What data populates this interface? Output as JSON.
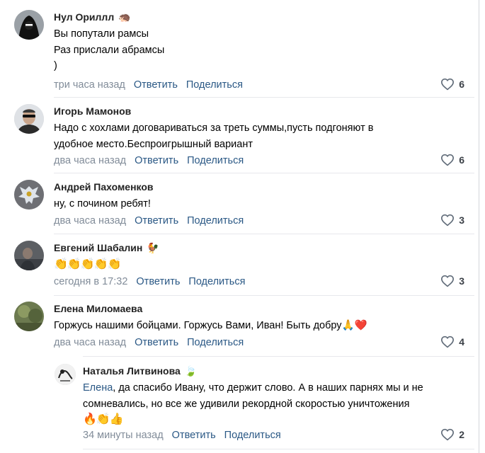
{
  "comments": [
    {
      "author": "Нул Ориллл",
      "badge": "🦔",
      "lines": [
        "Вы попутали рамсы",
        "Раз прислали абрамсы",
        ")"
      ],
      "time": "три часа назад",
      "reply_label": "Ответить",
      "share_label": "Поделиться",
      "likes": "6",
      "avatar_icon": "hooded-figure-icon"
    },
    {
      "author": "Игорь Мамонов",
      "lines": [
        "Надо с хохлами договариваться за треть суммы,пусть подгоняют в",
        "удобное место.Беспроигрышный вариант"
      ],
      "time": "два часа назад",
      "reply_label": "Ответить",
      "share_label": "Поделиться",
      "likes": "6",
      "avatar_icon": "man-sunglasses-icon"
    },
    {
      "author": "Андрей Пахоменков",
      "lines": [
        "ну, с почином ребят!"
      ],
      "time": "два часа назад",
      "reply_label": "Ответить",
      "share_label": "Поделиться",
      "likes": "3",
      "avatar_icon": "eagle-icon"
    },
    {
      "author": "Евгений Шабалин",
      "badge": "🐓",
      "lines": [
        "👏👏👏👏👏"
      ],
      "time": "сегодня в 17:32",
      "reply_label": "Ответить",
      "share_label": "Поделиться",
      "likes": "3",
      "avatar_icon": "man-portrait-icon"
    },
    {
      "author": "Елена Миломаева",
      "lines": [
        "Горжусь нашими бойцами. Горжусь Вами, Иван! Быть добру🙏❤️"
      ],
      "time": "два часа назад",
      "reply_label": "Ответить",
      "share_label": "Поделиться",
      "likes": "4",
      "avatar_icon": "nature-photo-icon"
    }
  ],
  "reply": {
    "author": "Наталья Литвинова",
    "badge": "🍃",
    "mention": "Елена",
    "lines_after_mention": ", да спасибо Ивану, что держит слово. А в наших парнях мы и не",
    "lines": [
      "сомневались, но все же удивили рекордной скоростью уничтожения",
      "🔥👏👍"
    ],
    "time": "34 минуты назад",
    "reply_label": "Ответить",
    "share_label": "Поделиться",
    "likes": "2",
    "avatar_icon": "sketch-drawing-icon"
  }
}
